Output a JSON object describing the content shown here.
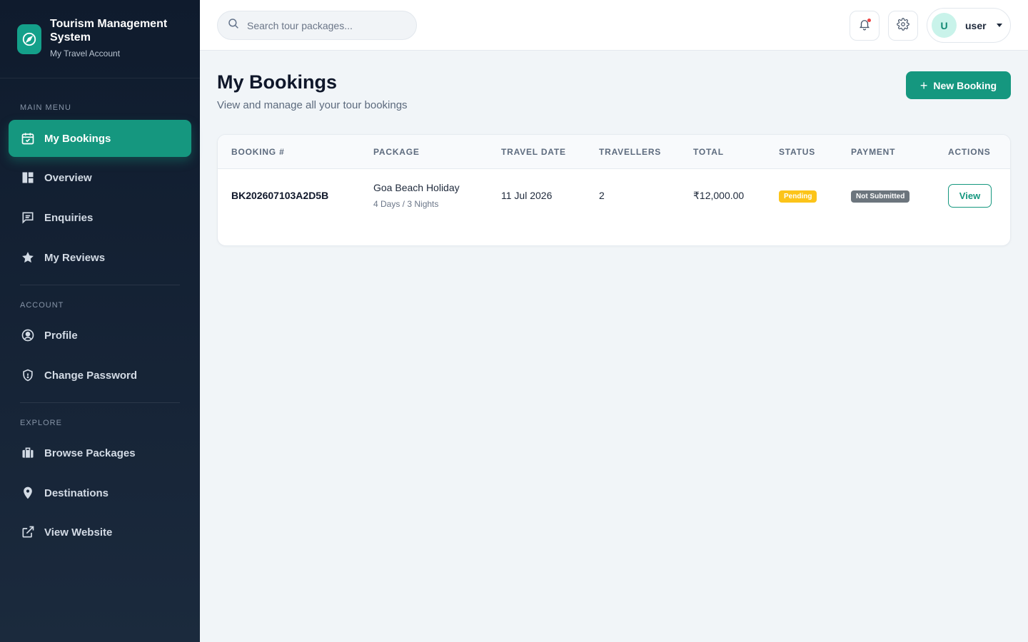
{
  "brand": {
    "title": "Tourism Management System",
    "subtitle": "My Travel Account",
    "logo_icon": "compass-icon"
  },
  "sidebar": {
    "sections": [
      {
        "label": "MAIN MENU"
      },
      {
        "label": "ACCOUNT"
      },
      {
        "label": "EXPLORE"
      }
    ],
    "items": [
      {
        "label": "My Bookings",
        "icon": "calendar-check-icon",
        "active": true
      },
      {
        "label": "Overview",
        "icon": "dashboard-icon"
      },
      {
        "label": "Enquiries",
        "icon": "chat-icon"
      },
      {
        "label": "My Reviews",
        "icon": "star-icon"
      },
      {
        "label": "Profile",
        "icon": "user-circle-icon"
      },
      {
        "label": "Change Password",
        "icon": "shield-icon"
      },
      {
        "label": "Browse Packages",
        "icon": "suitcase-icon"
      },
      {
        "label": "Destinations",
        "icon": "map-pin-icon"
      },
      {
        "label": "View Website",
        "icon": "external-link-icon"
      }
    ]
  },
  "header": {
    "search_placeholder": "Search tour packages...",
    "user": {
      "initial": "U",
      "name": "user"
    }
  },
  "main": {
    "title": "My Bookings",
    "subtitle": "View and manage all your tour bookings",
    "new_booking_label": "New Booking"
  },
  "table": {
    "columns": [
      "BOOKING #",
      "PACKAGE",
      "TRAVEL DATE",
      "TRAVELLERS",
      "TOTAL",
      "STATUS",
      "PAYMENT",
      "ACTIONS"
    ],
    "rows": [
      {
        "booking_no": "BK202607103A2D5B",
        "package_name": "Goa Beach Holiday",
        "package_duration": "4 Days / 3 Nights",
        "travel_date": "11 Jul 2026",
        "travellers": "2",
        "total": "₹12,000.00",
        "status": "Pending",
        "payment": "Not Submitted",
        "action_label": "View"
      }
    ]
  },
  "colors": {
    "accent": "#15977f",
    "sidebar_bg": "#0f1b2d",
    "pending": "#fcc419",
    "not_submitted": "#6c757d"
  }
}
